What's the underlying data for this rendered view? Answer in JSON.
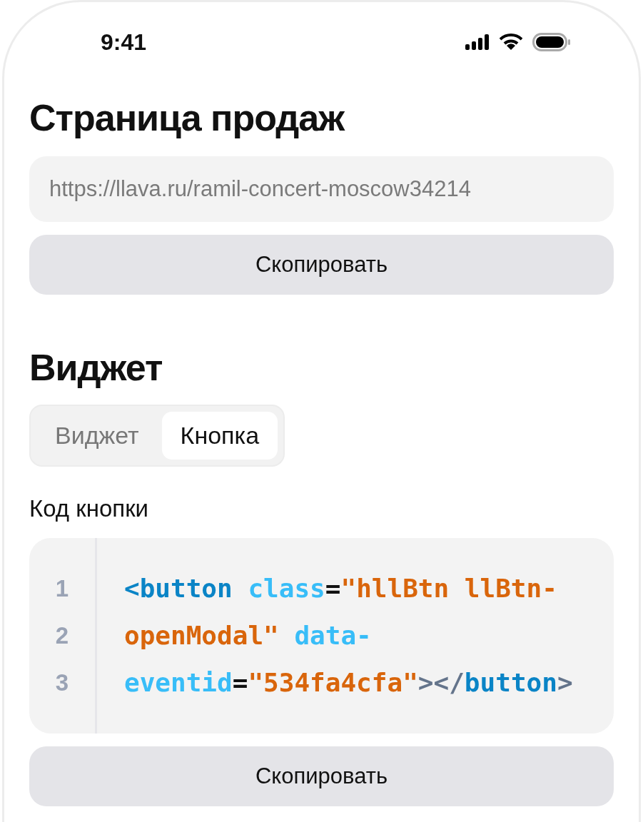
{
  "status_bar": {
    "time": "9:41"
  },
  "sales_page": {
    "title": "Страница продаж",
    "url_field": {
      "value": "https://llava.ru/ramil-concert-moscow34214"
    },
    "copy_button": "Скопировать"
  },
  "widget": {
    "title": "Виджет",
    "tabs": [
      {
        "label": "Виджет",
        "selected": false
      },
      {
        "label": "Кнопка",
        "selected": true
      }
    ],
    "code_label": "Код кнопки",
    "code": {
      "lines": [
        {
          "number": "1",
          "tokens": [
            {
              "kind": "tag",
              "text": "<button"
            },
            {
              "kind": "attr",
              "text": " class"
            },
            {
              "kind": "eq",
              "text": "="
            },
            {
              "kind": "string",
              "text": "\"hllBtn llBtn-"
            }
          ]
        },
        {
          "number": "2",
          "tokens": [
            {
              "kind": "string",
              "text": "openModal\""
            },
            {
              "kind": "attr",
              "text": " data-"
            }
          ]
        },
        {
          "number": "3",
          "tokens": [
            {
              "kind": "attr",
              "text": "eventid"
            },
            {
              "kind": "eq",
              "text": "="
            },
            {
              "kind": "string",
              "text": "\"534fa4cfa\""
            },
            {
              "kind": "bracket",
              "text": "></"
            },
            {
              "kind": "tag",
              "text": "button"
            },
            {
              "kind": "bracket",
              "text": ">"
            }
          ]
        }
      ]
    },
    "copy_button": "Скопировать"
  }
}
